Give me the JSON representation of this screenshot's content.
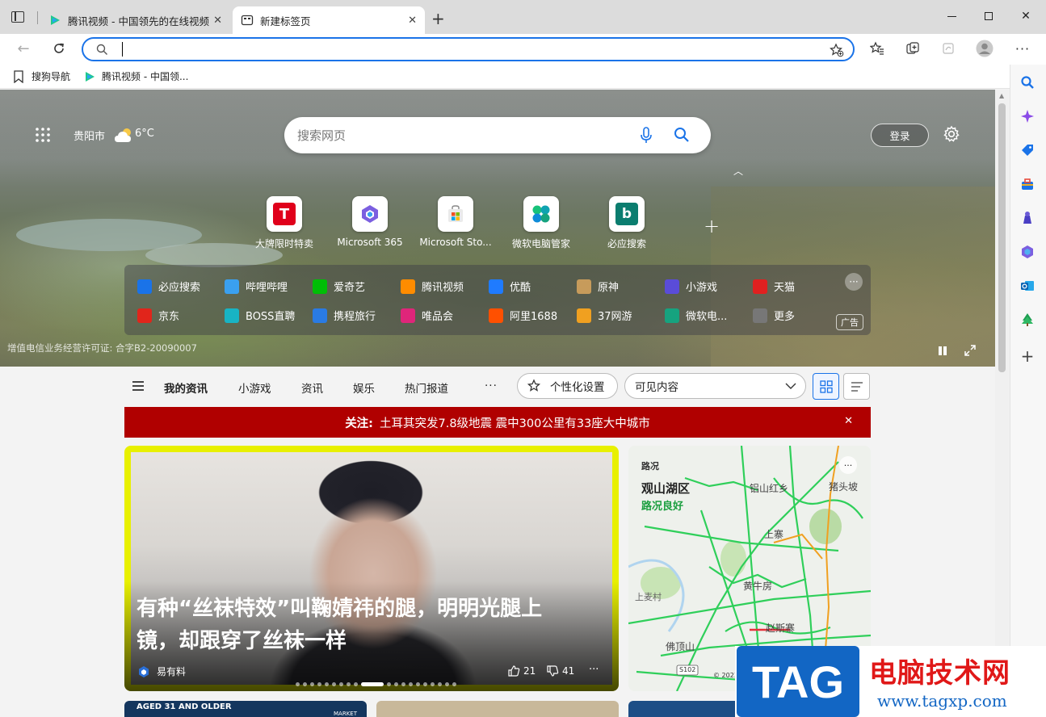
{
  "tabs": [
    {
      "title": "腾讯视频 - 中国领先的在线视频",
      "active": false
    },
    {
      "title": "新建标签页",
      "active": true
    }
  ],
  "address": {
    "value": "",
    "placeholder": ""
  },
  "favorites": [
    {
      "label": "搜狗导航"
    },
    {
      "label": "腾讯视频 - 中国领..."
    }
  ],
  "weather": {
    "city": "贵阳市",
    "temp": "6°C"
  },
  "search": {
    "placeholder": "搜索网页"
  },
  "login_label": "登录",
  "quick_links": [
    {
      "label": "大牌限时特卖",
      "color": "#e0001b"
    },
    {
      "label": "Microsoft 365",
      "color": "#6b5bd6"
    },
    {
      "label": "Microsoft Sto...",
      "color": "#0078d4"
    },
    {
      "label": "微软电脑管家",
      "color": "#16a37f"
    },
    {
      "label": "必应搜索",
      "color": "#0b7d6f"
    }
  ],
  "site_links": [
    [
      {
        "label": "必应搜索",
        "icon": "search",
        "color": "#1a73e8"
      },
      {
        "label": "哔哩哔哩",
        "icon": "tv",
        "color": "#3aa0f0"
      },
      {
        "label": "爱奇艺",
        "icon": "iq",
        "color": "#00be06"
      },
      {
        "label": "腾讯视频",
        "icon": "play",
        "color": "#ff8c00"
      },
      {
        "label": "优酷",
        "icon": "yk",
        "color": "#1f7bff"
      },
      {
        "label": "原神",
        "icon": "ys",
        "color": "#c79b5b"
      },
      {
        "label": "小游戏",
        "icon": "game",
        "color": "#5a4cd8"
      },
      {
        "label": "天猫",
        "icon": "tm",
        "color": "#e02020"
      }
    ],
    [
      {
        "label": "京东",
        "icon": "JD",
        "color": "#e1251b"
      },
      {
        "label": "BOSS直聘",
        "icon": "boss",
        "color": "#18b4c4"
      },
      {
        "label": "携程旅行",
        "icon": "xc",
        "color": "#2a7be4"
      },
      {
        "label": "唯品会",
        "icon": "唯",
        "color": "#e0257a"
      },
      {
        "label": "阿里1688",
        "icon": "ali",
        "color": "#ff5000"
      },
      {
        "label": "37网游",
        "icon": "37",
        "color": "#f0a020"
      },
      {
        "label": "微软电...",
        "icon": "ms",
        "color": "#16a37f"
      },
      {
        "label": "更多",
        "icon": "more",
        "color": "#777"
      }
    ]
  ],
  "ad_label": "广告",
  "license": "增值电信业务经营许可证: 合字B2-20090007",
  "news_tabs": [
    "我的资讯",
    "小游戏",
    "资讯",
    "娱乐",
    "热门报道"
  ],
  "personalize_label": "个性化设置",
  "visible_content_label": "可见内容",
  "banner": {
    "prefix": "关注:",
    "text": "土耳其突发7.8级地震 震中300公里有33座大中城市"
  },
  "card1": {
    "title_line1": "有种“丝袜特效”叫鞠婧祎的腿，明明光腿上",
    "title_line2": "镜，却跟穿了丝袜一样",
    "source": "易有料",
    "likes": "21",
    "dislikes": "41"
  },
  "card2": {
    "label": "路况",
    "area": "观山湖区",
    "status": "路况良好",
    "places": [
      "铝山红乡",
      "猪头坡",
      "上寨",
      "黄牛房",
      "上麦村",
      "赵斯寨",
      "佛顶山"
    ],
    "road": "S102",
    "copyright": "© 2023"
  },
  "bottom_card_text": "AGED 31 AND OLDER",
  "bottom_card_text2": "MARKET",
  "watermark": {
    "tag": "TAG",
    "title": "电脑技术网",
    "url": "www.tagxp.com"
  },
  "colors": {
    "accent": "#1a73e8",
    "banner": "#b00000",
    "traffic_green": "#2fcf5a"
  }
}
